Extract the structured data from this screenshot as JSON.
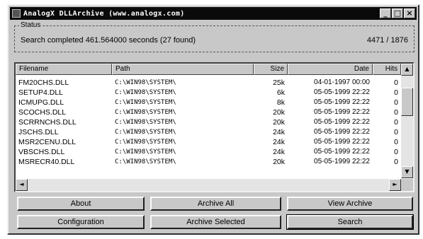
{
  "window": {
    "title": "AnalogX DLLArchive (www.analogx.com)",
    "minimize_glyph": "_",
    "maximize_glyph": "□",
    "close_glyph": "×"
  },
  "status": {
    "legend": "Status",
    "message": "Search completed 461.564000 seconds (27 found)",
    "count": "4471 / 1876"
  },
  "table": {
    "columns": [
      "Filename",
      "Path",
      "Size",
      "Date",
      "Hits"
    ],
    "rows": [
      {
        "filename": "FM20CHS.DLL",
        "path": "C:\\WIN98\\SYSTEM\\",
        "size": "25k",
        "date": "04-01-1997 00:00",
        "hits": "0"
      },
      {
        "filename": "SETUP4.DLL",
        "path": "C:\\WIN98\\SYSTEM\\",
        "size": "6k",
        "date": "05-05-1999 22:22",
        "hits": "0"
      },
      {
        "filename": "ICMUPG.DLL",
        "path": "C:\\WIN98\\SYSTEM\\",
        "size": "8k",
        "date": "05-05-1999 22:22",
        "hits": "0"
      },
      {
        "filename": "SCOCHS.DLL",
        "path": "C:\\WIN98\\SYSTEM\\",
        "size": "20k",
        "date": "05-05-1999 22:22",
        "hits": "0"
      },
      {
        "filename": "SCRRNCHS.DLL",
        "path": "C:\\WIN98\\SYSTEM\\",
        "size": "20k",
        "date": "05-05-1999 22:22",
        "hits": "0"
      },
      {
        "filename": "JSCHS.DLL",
        "path": "C:\\WIN98\\SYSTEM\\",
        "size": "24k",
        "date": "05-05-1999 22:22",
        "hits": "0"
      },
      {
        "filename": "MSR2CENU.DLL",
        "path": "C:\\WIN98\\SYSTEM\\",
        "size": "24k",
        "date": "05-05-1999 22:22",
        "hits": "0"
      },
      {
        "filename": "VBSCHS.DLL",
        "path": "C:\\WIN98\\SYSTEM\\",
        "size": "24k",
        "date": "05-05-1999 22:22",
        "hits": "0"
      },
      {
        "filename": "MSRECR40.DLL",
        "path": "C:\\WIN98\\SYSTEM\\",
        "size": "20k",
        "date": "05-05-1999 22:22",
        "hits": "0"
      }
    ]
  },
  "scroll": {
    "up": "▲",
    "down": "▼",
    "left": "◄",
    "right": "►"
  },
  "buttons": {
    "about": "About",
    "archive_all": "Archive All",
    "view_archive": "View Archive",
    "configuration": "Configuration",
    "archive_selected": "Archive Selected",
    "search": "Search"
  }
}
